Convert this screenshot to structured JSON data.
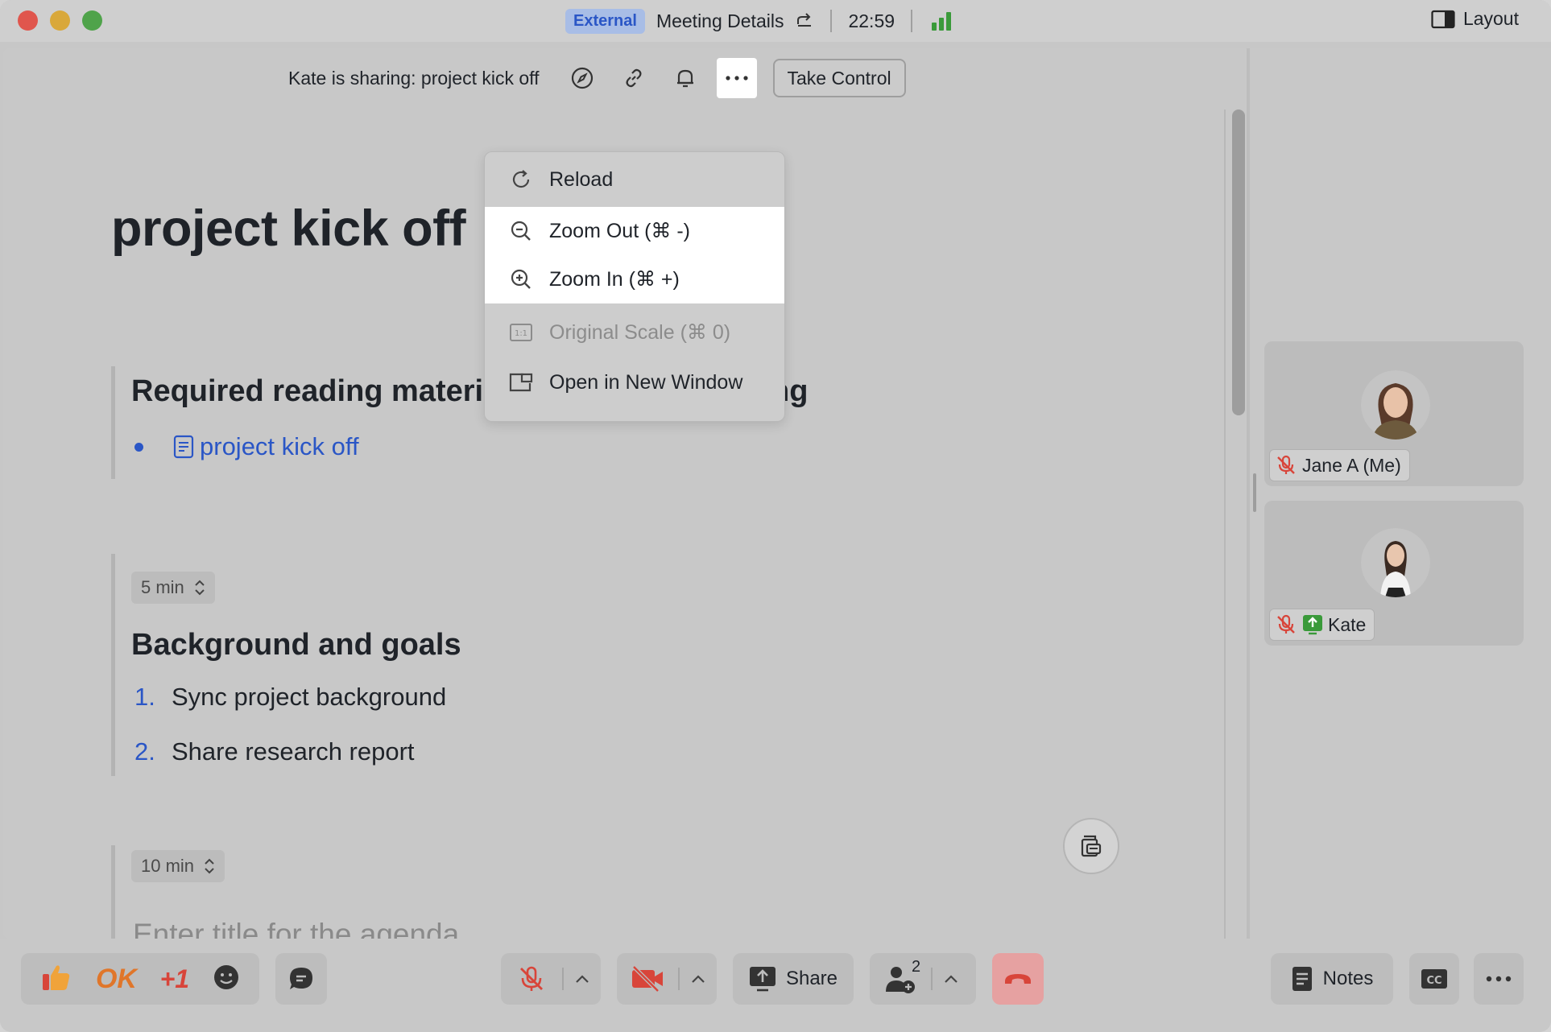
{
  "titlebar": {
    "badge": "External",
    "title": "Meeting Details",
    "time": "22:59",
    "layout_label": "Layout"
  },
  "share_bar": {
    "sharing_text": "Kate is sharing: project kick off",
    "take_control_label": "Take Control"
  },
  "menu": {
    "items": [
      {
        "label": "Reload",
        "icon": "reload-icon",
        "state": "normal"
      },
      {
        "label": "Zoom Out (⌘ -)",
        "icon": "zoom-out-icon",
        "state": "highlighted"
      },
      {
        "label": "Zoom In (⌘ +)",
        "icon": "zoom-in-icon",
        "state": "highlighted"
      },
      {
        "label": "Original Scale (⌘ 0)",
        "icon": "original-scale-icon",
        "state": "disabled"
      },
      {
        "label": "Open in New Window",
        "icon": "new-window-icon",
        "state": "normal"
      }
    ]
  },
  "document": {
    "title": "project kick off",
    "sections": [
      {
        "heading": "Required reading materials before the meeting",
        "links": [
          "project kick off"
        ]
      },
      {
        "time": "5 min",
        "heading": "Background and goals",
        "items": [
          {
            "num": "1.",
            "text": "Sync project background"
          },
          {
            "num": "2.",
            "text": "Share research report"
          }
        ]
      },
      {
        "time": "10 min",
        "placeholder": "Enter title for the agenda"
      }
    ]
  },
  "participants": [
    {
      "name": "Jane A  (Me)",
      "muted": true
    },
    {
      "name": "Kate",
      "muted": true,
      "sharing": true
    }
  ],
  "toolbar": {
    "reactions": [
      "thumbs-up",
      "OK",
      "+1",
      "emoji"
    ],
    "ok_label": "OK",
    "plus_one_label": "+1",
    "share_label": "Share",
    "participant_count": "2",
    "notes_label": "Notes"
  },
  "colors": {
    "accent": "#2a56c6",
    "signal": "#3a9a3a",
    "end_call": "#d8453a"
  }
}
